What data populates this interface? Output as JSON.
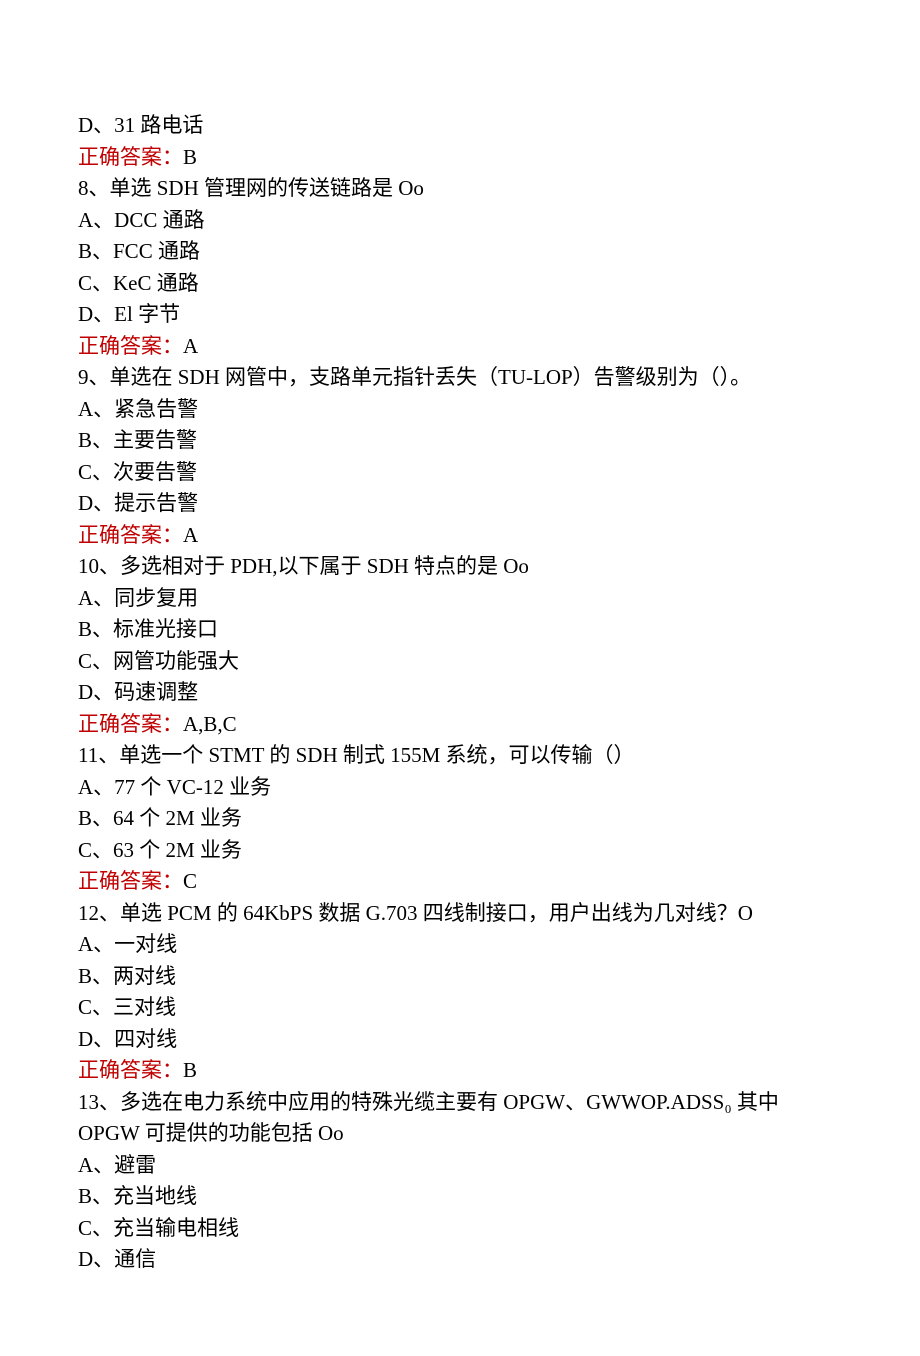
{
  "lines": {
    "l1": "D、31 路电话",
    "l2a": "正确答案：",
    "l2b": "B",
    "l3": "8、单选 SDH 管理网的传送链路是 Oo",
    "l4": "A、DCC 通路",
    "l5": "B、FCC 通路",
    "l6": "C、KeC 通路",
    "l7": "D、El 字节",
    "l8a": "正确答案：",
    "l8b": "A",
    "l9": "9、单选在 SDH 网管中，支路单元指针丢失（TU-LOP）告警级别为（）。",
    "l10": "A、紧急告警",
    "l11": "B、主要告警",
    "l12": "C、次要告警",
    "l13": "D、提示告警",
    "l14a": "正确答案：",
    "l14b": "A",
    "l15": "10、多选相对于 PDH,以下属于 SDH 特点的是 Oo",
    "l16": "A、同步复用",
    "l17": "B、标准光接口",
    "l18": "C、网管功能强大",
    "l19": "D、码速调整",
    "l20a": "正确答案：",
    "l20b": "A,B,C",
    "l21": "11、单选一个 STMT 的 SDH 制式 155M 系统，可以传输（）",
    "l22": "A、77 个 VC-12 业务",
    "l23": "B、64 个 2M 业务",
    "l24": "C、63 个 2M 业务",
    "l25a": "正确答案：",
    "l25b": "C",
    "l26": "12、单选 PCM 的 64KbPS 数据 G.703 四线制接口，用户出线为几对线？O",
    "l27": "A、一对线",
    "l28": "B、两对线",
    "l29": "C、三对线",
    "l30": "D、四对线",
    "l31a": "正确答案：",
    "l31b": "B",
    "l32": "13、多选在电力系统中应用的特殊光缆主要有 OPGW、GWWOP.ADSS₀ 其中 OPGW 可提供的功能包括 Oo",
    "l33": "A、避雷",
    "l34": "B、充当地线",
    "l35": "C、充当输电相线",
    "l36": "D、通信"
  }
}
